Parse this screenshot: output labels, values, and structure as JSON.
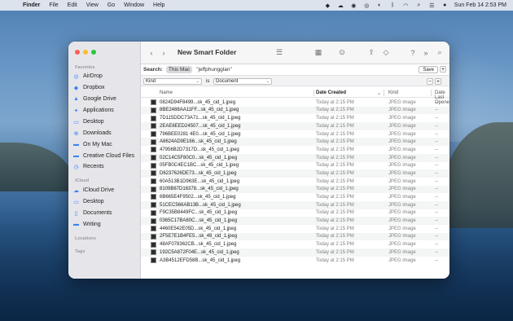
{
  "menubar": {
    "app": "Finder",
    "items": [
      "File",
      "Edit",
      "View",
      "Go",
      "Window",
      "Help"
    ],
    "datetime": "Sun Feb 14  2:53 PM"
  },
  "window": {
    "title": "New Smart Folder",
    "search": {
      "label": "Search:",
      "scope_this_mac": "This Mac",
      "scope_user": "\"jeffphungglan\"",
      "save": "Save",
      "add": "+"
    },
    "criteria": {
      "attribute": "Kind",
      "operator": "is",
      "value": "Document",
      "minus": "−",
      "plus": "+"
    },
    "columns": {
      "name": "Name",
      "date_created": "Date Created",
      "kind": "Kind",
      "date_last_opened": "Date Last Opened"
    },
    "files": [
      {
        "name": "0824D94F8499...sk_45_cid_1.jpeg",
        "created": "Today at 2:15 PM",
        "kind": "JPEG image",
        "opened": "--"
      },
      {
        "name": "8BE2488AA11FF...sk_45_cid_1.jpeg",
        "created": "Today at 2:15 PM",
        "kind": "JPEG image",
        "opened": "--"
      },
      {
        "name": "7D115DDC73A71...sk_45_cid_1.jpeg",
        "created": "Today at 2:15 PM",
        "kind": "JPEG image",
        "opened": "--"
      },
      {
        "name": "2EAE6EED24507...sk_45_cid_1.jpeg",
        "created": "Today at 2:15 PM",
        "kind": "JPEG image",
        "opened": "--"
      },
      {
        "name": "796BEE0281 4E0...sk_45_cid_1.jpeg",
        "created": "Today at 2:15 PM",
        "kind": "JPEG image",
        "opened": "--"
      },
      {
        "name": "A8624AD9E166...sk_45_cid_1.jpeg",
        "created": "Today at 2:15 PM",
        "kind": "JPEG image",
        "opened": "--"
      },
      {
        "name": "47956B2D7317D...sk_45_cid_1.jpeg",
        "created": "Today at 2:15 PM",
        "kind": "JPEG image",
        "opened": "--"
      },
      {
        "name": "02C14C5F80C0...sk_45_cid_1.jpeg",
        "created": "Today at 2:15 PM",
        "kind": "JPEG image",
        "opened": "--"
      },
      {
        "name": "05FB0C4EC1BC...sk_45_cid_1.jpeg",
        "created": "Today at 2:15 PM",
        "kind": "JPEG image",
        "opened": "--"
      },
      {
        "name": "D6237626DE73...sk_45_cid_1.jpeg",
        "created": "Today at 2:15 PM",
        "kind": "JPEG image",
        "opened": "--"
      },
      {
        "name": "60A513B1D963E...sk_45_cid_1.jpeg",
        "created": "Today at 2:15 PM",
        "kind": "JPEG image",
        "opened": "--"
      },
      {
        "name": "8109B87D16378...sk_45_cid_1.jpeg",
        "created": "Today at 2:15 PM",
        "kind": "JPEG image",
        "opened": "--"
      },
      {
        "name": "6B665E4F9502...sk_45_cid_1.jpeg",
        "created": "Today at 2:15 PM",
        "kind": "JPEG image",
        "opened": "--"
      },
      {
        "name": "51CEC566AB13B...sk_45_cid_1.jpeg",
        "created": "Today at 2:15 PM",
        "kind": "JPEG image",
        "opened": "--"
      },
      {
        "name": "F9C35B8449FC...sk_45_cid_1.jpeg",
        "created": "Today at 2:15 PM",
        "kind": "JPEG image",
        "opened": "--"
      },
      {
        "name": "0365C17BA80C...sk_45_cid_1.jpeg",
        "created": "Today at 2:15 PM",
        "kind": "JPEG image",
        "opened": "--"
      },
      {
        "name": "4460E542E05D...sk_45_cid_1.jpeg",
        "created": "Today at 2:15 PM",
        "kind": "JPEG image",
        "opened": "--"
      },
      {
        "name": "2F5E7E1B4FE5...sk_49_cid_1.jpeg",
        "created": "Today at 2:15 PM",
        "kind": "JPEG image",
        "opened": "--"
      },
      {
        "name": "48AF078362CB...sk_45_cid_1.jpeg",
        "created": "Today at 2:15 PM",
        "kind": "JPEG image",
        "opened": "--"
      },
      {
        "name": "192C5A872F04E...sk_45_cid_1.jpeg",
        "created": "Today at 2:15 PM",
        "kind": "JPEG image",
        "opened": "--"
      },
      {
        "name": "A3B4512EFD58B...sk_45_cid_1.jpeg",
        "created": "Today at 2:15 PM",
        "kind": "JPEG image",
        "opened": "--"
      }
    ]
  },
  "sidebar": {
    "favorites_label": "Favorites",
    "favorites": [
      {
        "label": "AirDrop",
        "icon": "airdrop-icon"
      },
      {
        "label": "Dropbox",
        "icon": "dropbox-icon"
      },
      {
        "label": "Google Drive",
        "icon": "google-drive-icon"
      },
      {
        "label": "Applications",
        "icon": "applications-icon"
      },
      {
        "label": "Desktop",
        "icon": "desktop-icon"
      },
      {
        "label": "Downloads",
        "icon": "downloads-icon"
      },
      {
        "label": "On My Mac",
        "icon": "folder-icon"
      },
      {
        "label": "Creative Cloud Files",
        "icon": "folder-icon"
      },
      {
        "label": "Recents",
        "icon": "recents-icon"
      }
    ],
    "icloud_label": "iCloud",
    "icloud": [
      {
        "label": "iCloud Drive",
        "icon": "icloud-icon"
      },
      {
        "label": "Desktop",
        "icon": "desktop-icon"
      },
      {
        "label": "Documents",
        "icon": "document-icon"
      },
      {
        "label": "Writing",
        "icon": "folder-icon"
      }
    ],
    "locations_label": "Locations",
    "tags_label": "Tags"
  },
  "colors": {
    "accent": "#3c82f6",
    "close": "#fe5f57",
    "minimize": "#febc2e",
    "zoom": "#28c840"
  }
}
